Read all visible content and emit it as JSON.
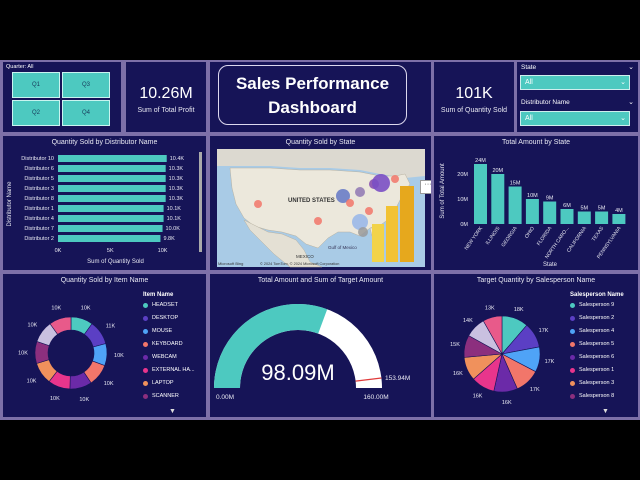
{
  "quarter": {
    "label": "Quarter: All",
    "options": [
      "Q1",
      "Q3",
      "Q2",
      "Q4"
    ]
  },
  "profit": {
    "value": "10.26M",
    "label": "Sum of Total Profit"
  },
  "title": {
    "line1": "Sales Performance",
    "line2": "Dashboard"
  },
  "qty": {
    "value": "101K",
    "label": "Sum of Quantity Sold"
  },
  "state_slicer": {
    "label": "State",
    "value": "All"
  },
  "dist_slicer": {
    "label": "Distributor Name",
    "value": "All"
  },
  "dist_chart": {
    "title": "Quantity Sold by Distributor Name",
    "ylabel": "Distributor Name",
    "xlabel": "Sum of Quantity Sold",
    "ticks": [
      "0K",
      "5K",
      "10K"
    ],
    "categories": [
      "Distributor 10",
      "Distributor 6",
      "Distributor 5",
      "Distributor 3",
      "Distributor 8",
      "Distributor 1",
      "Distributor 4",
      "Distributor 7",
      "Distributor 2"
    ],
    "values": [
      10.4,
      10.3,
      10.3,
      10.3,
      10.3,
      10.1,
      10.1,
      10.0,
      9.8
    ],
    "labels": [
      "10.4K",
      "10.3K",
      "10.3K",
      "10.3K",
      "10.3K",
      "10.1K",
      "10.1K",
      "10.0K",
      "9.8K"
    ]
  },
  "map": {
    "title": "Quantity Sold by State",
    "labels": {
      "us": "UNITED STATES",
      "mexico": "MEXICO",
      "gulf": "Gulf of Mexico"
    },
    "attribution": "© 2024 TomTom, © 2024 Microsoft Corporation",
    "logo": "Microsoft Bing",
    "more": "···"
  },
  "state_chart": {
    "title": "Total Amount by State",
    "ylabel": "Sum of Total Amount",
    "xlabel": "State",
    "yticks": [
      "0M",
      "10M",
      "20M"
    ],
    "categories": [
      "NEW YORK",
      "ILLINOIS",
      "GEORGIA",
      "OHIO",
      "FLORIDA",
      "NORTH CARO...",
      "CALIFORNIA",
      "TEXAS",
      "PENNSYLVANIA"
    ],
    "values": [
      24,
      20,
      15,
      10,
      9,
      6,
      5,
      5,
      4
    ],
    "labels": [
      "24M",
      "20M",
      "15M",
      "10M",
      "9M",
      "6M",
      "5M",
      "5M",
      "4M"
    ]
  },
  "item_chart": {
    "title": "Quantity Sold by Item Name",
    "legend_title": "Item Name",
    "items": [
      "HEADSET",
      "DESKTOP",
      "MOUSE",
      "KEYBOARD",
      "WEBCAM",
      "EXTERNAL HA...",
      "LAPTOP",
      "SCANNER"
    ],
    "colors": [
      "#4dc9c0",
      "#5b3fc4",
      "#4fa3f7",
      "#f2766a",
      "#6b2aa8",
      "#e8358c",
      "#f0915c",
      "#8c2f7e",
      "#c9c0e0",
      "#e85a8a"
    ],
    "slice_values": [
      10,
      11,
      10,
      10,
      10,
      10,
      10,
      10,
      10,
      10
    ],
    "slice_labels": [
      "10K",
      "11K",
      "10K",
      "10K",
      "10K",
      "10K",
      "10K",
      "10K",
      "10K",
      "10K"
    ]
  },
  "gauge": {
    "title": "Total Amount and Sum of Target Amount",
    "value_label": "98.09M",
    "min_label": "0.00M",
    "max_label": "160.00M",
    "target_label": "153.94M",
    "value": 98.09,
    "min": 0,
    "max": 160,
    "target": 153.94
  },
  "sp_chart": {
    "title": "Target Quantity by Salesperson Name",
    "legend_title": "Salesperson Name",
    "items": [
      "Salesperson 9",
      "Salesperson 2",
      "Salesperson 4",
      "Salesperson 5",
      "Salesperson 6",
      "Salesperson 1",
      "Salesperson 3",
      "Salesperson 8"
    ],
    "colors": [
      "#4dc9c0",
      "#5b3fc4",
      "#4fa3f7",
      "#f2766a",
      "#6b2aa8",
      "#e8358c",
      "#f0915c",
      "#8c2f7e",
      "#c9c0e0",
      "#e85a8a"
    ],
    "slice_values": [
      18,
      17,
      17,
      17,
      16,
      16,
      16,
      15,
      14,
      13
    ],
    "slice_labels": [
      "18K",
      "17K",
      "17K",
      "17K",
      "16K",
      "16K",
      "16K",
      "15K",
      "14K",
      "13K"
    ]
  }
}
